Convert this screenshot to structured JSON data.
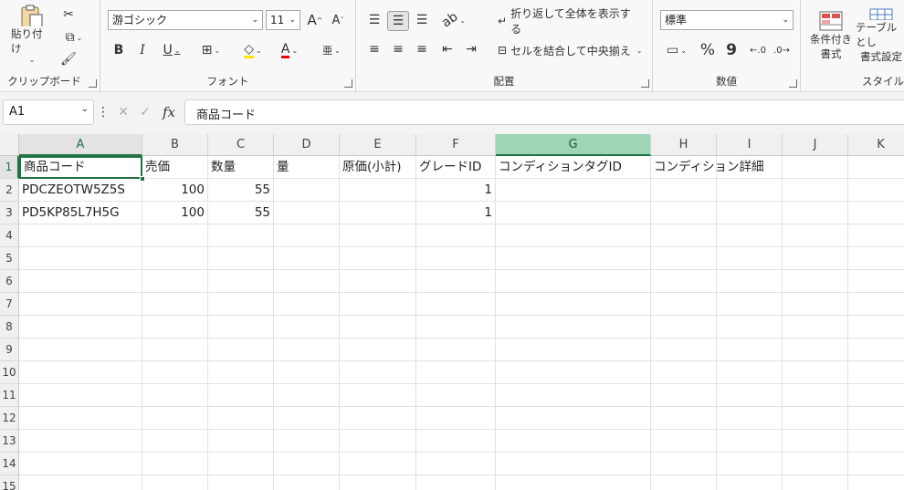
{
  "ribbon": {
    "clipboard": {
      "paste": "貼り付け",
      "label": "クリップボード"
    },
    "font": {
      "name": "游ゴシック",
      "size": "11",
      "label": "フォント",
      "grow": "A",
      "shrink": "A",
      "bold": "B",
      "italic": "I",
      "underline": "U",
      "font_color": "A"
    },
    "alignment": {
      "wrap": "折り返して全体を表示する",
      "merge": "セルを結合して中央揃え",
      "label": "配置"
    },
    "number": {
      "format": "標準",
      "percent": "%",
      "comma": "9",
      "label": "数値"
    },
    "styles": {
      "cond1": "条件付き",
      "cond2": "書式",
      "table1": "テーブルとし",
      "table2": "書式設定",
      "label": "スタイル"
    }
  },
  "formula_bar": {
    "name_box": "A1",
    "fx": "fx",
    "content": "商品コード"
  },
  "columns": [
    "A",
    "B",
    "C",
    "D",
    "E",
    "F",
    "G",
    "H",
    "I",
    "J",
    "K"
  ],
  "rows": [
    "1",
    "2",
    "3",
    "4",
    "5",
    "6",
    "7",
    "8",
    "9",
    "10",
    "11",
    "12",
    "13",
    "14",
    "15"
  ],
  "sheet": {
    "header": [
      "商品コード",
      "売価",
      "数量",
      "量",
      "原価(小計)",
      "グレードID",
      "コンディションタグID",
      "コンディション詳細"
    ],
    "r2": [
      "PDCZEOTW5Z5S",
      "100",
      "55",
      "",
      "",
      "1",
      "",
      ""
    ],
    "r3": [
      "PD5KP85L7H5G",
      "100",
      "55",
      "",
      "",
      "1",
      "",
      ""
    ]
  },
  "colors": {
    "accent": "#217346",
    "selected_col": "#9fd5b7"
  }
}
